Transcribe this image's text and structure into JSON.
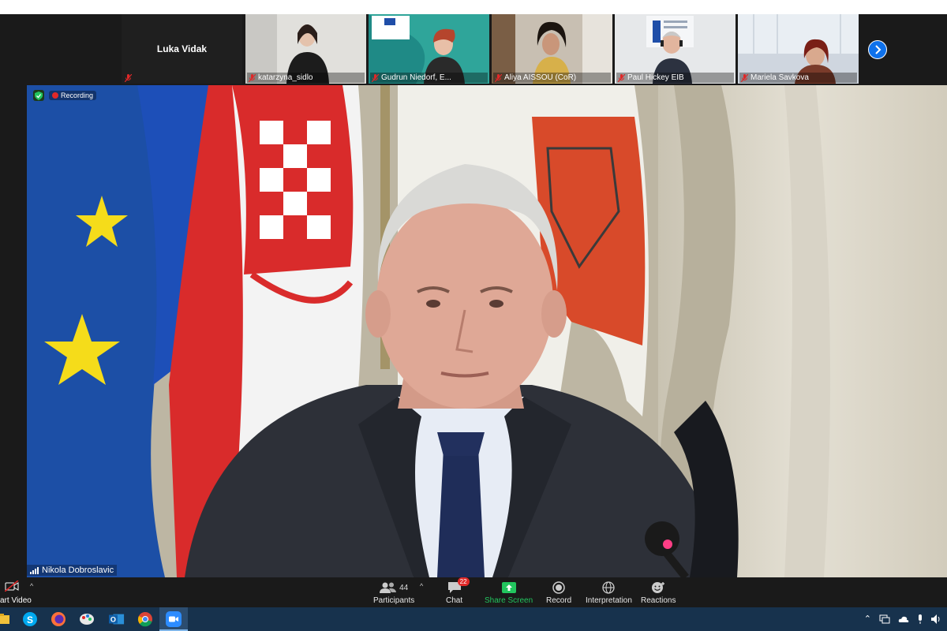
{
  "participants": [
    {
      "name": "Luka Vidak",
      "video": false
    },
    {
      "name": "katarzyna_sidlo",
      "video": true
    },
    {
      "name": "Gudrun Niedorf, E...",
      "video": true
    },
    {
      "name": "Aliya AISSOU (CoR)",
      "video": true
    },
    {
      "name": "Paul Hickey EIB",
      "video": true
    },
    {
      "name": "Mariela Savkova",
      "video": true
    }
  ],
  "main": {
    "recording_label": "Recording",
    "speaker_name": "Nikola Dobroslavic"
  },
  "toolbar": {
    "start_video_label": "art Video",
    "participants_label": "Participants",
    "participants_count": "44",
    "chat_label": "Chat",
    "chat_badge": "22",
    "share_label": "Share Screen",
    "record_label": "Record",
    "interpretation_label": "Interpretation",
    "reactions_label": "Reactions"
  },
  "colors": {
    "zoom_blue": "#0e71eb",
    "share_green": "#22c55e",
    "badge_red": "#e02828",
    "taskbar": "#17324d"
  }
}
